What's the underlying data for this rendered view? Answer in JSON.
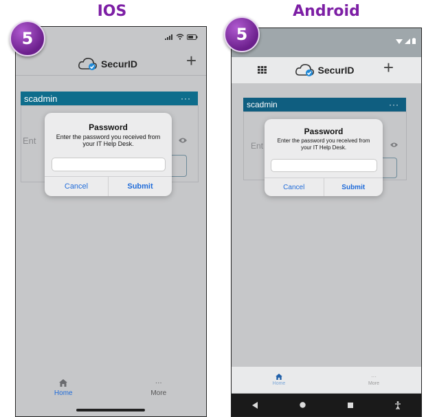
{
  "headings": {
    "ios": "IOS",
    "android": "Android"
  },
  "step_badge": "5",
  "app": {
    "brand": "SecurID",
    "account": "scadmin",
    "account_menu": "···",
    "field_hint": "Ent"
  },
  "dialog": {
    "title": "Password",
    "message_line1": "Enter the password you received from",
    "message_line2": "your IT Help Desk.",
    "input_value": "",
    "cancel": "Cancel",
    "submit": "Submit"
  },
  "tabs": {
    "home": "Home",
    "more": "More",
    "more_glyph": "···"
  },
  "colors": {
    "accent_purple": "#7d1fa5",
    "card_header_ios": "#0e6d8c",
    "card_header_android": "#0f5e80",
    "link_blue": "#1f6bd9",
    "status_bar_android": "#9fa7ab"
  },
  "icons": [
    "cloud-check-icon",
    "plus-icon",
    "grid-icon",
    "eye-icon",
    "home-icon",
    "more-icon",
    "wifi-icon",
    "signal-icon",
    "battery-icon"
  ]
}
